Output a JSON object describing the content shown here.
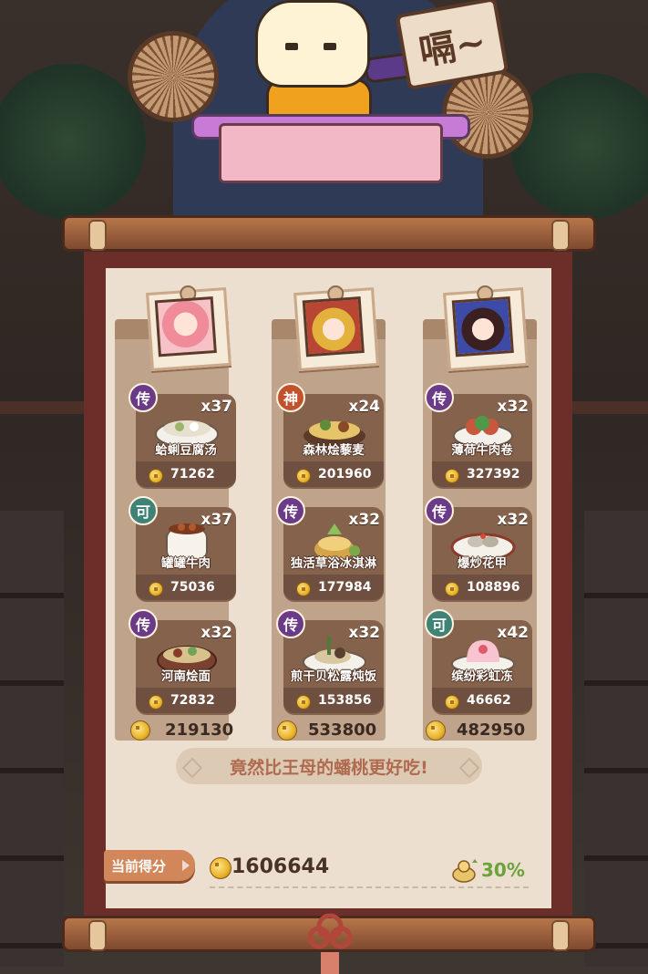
{
  "speech_text": "嗝~",
  "columns": [
    {
      "character": "pink-haired-girl",
      "total": "219130",
      "dishes": [
        {
          "rarity": "传",
          "qty": "x37",
          "name": "蛤蜊豆腐汤",
          "score": "71262"
        },
        {
          "rarity": "可",
          "qty": "x37",
          "name": "罐罐牛肉",
          "score": "75036"
        },
        {
          "rarity": "传",
          "qty": "x32",
          "name": "河南烩面",
          "score": "72832"
        }
      ]
    },
    {
      "character": "crowned-deity",
      "total": "533800",
      "dishes": [
        {
          "rarity": "神",
          "qty": "x24",
          "name": "森林烩藜麦",
          "score": "201960"
        },
        {
          "rarity": "传",
          "qty": "x32",
          "name": "独活草浴冰淇淋",
          "score": "177984"
        },
        {
          "rarity": "传",
          "qty": "x32",
          "name": "煎干贝松露炖饭",
          "score": "153856"
        }
      ]
    },
    {
      "character": "dark-haired-boy",
      "total": "482950",
      "dishes": [
        {
          "rarity": "传",
          "qty": "x32",
          "name": "薄荷牛肉卷",
          "score": "327392"
        },
        {
          "rarity": "传",
          "qty": "x32",
          "name": "爆炒花甲",
          "score": "108896"
        },
        {
          "rarity": "可",
          "qty": "x42",
          "name": "缤纷彩虹冻",
          "score": "46662"
        }
      ]
    }
  ],
  "comment": "竟然比王母的蟠桃更好吃!",
  "score_label": "当前得分",
  "total_score": "1606644",
  "bonus_percent": "30%",
  "colors": {
    "scroll_frame": "#6c2e28",
    "paper": "#ecdfcf",
    "rarity_chuan": "#6c3b87",
    "rarity_shen": "#c2512e",
    "rarity_ke": "#3f8377",
    "bonus_green": "#6aa33a"
  }
}
